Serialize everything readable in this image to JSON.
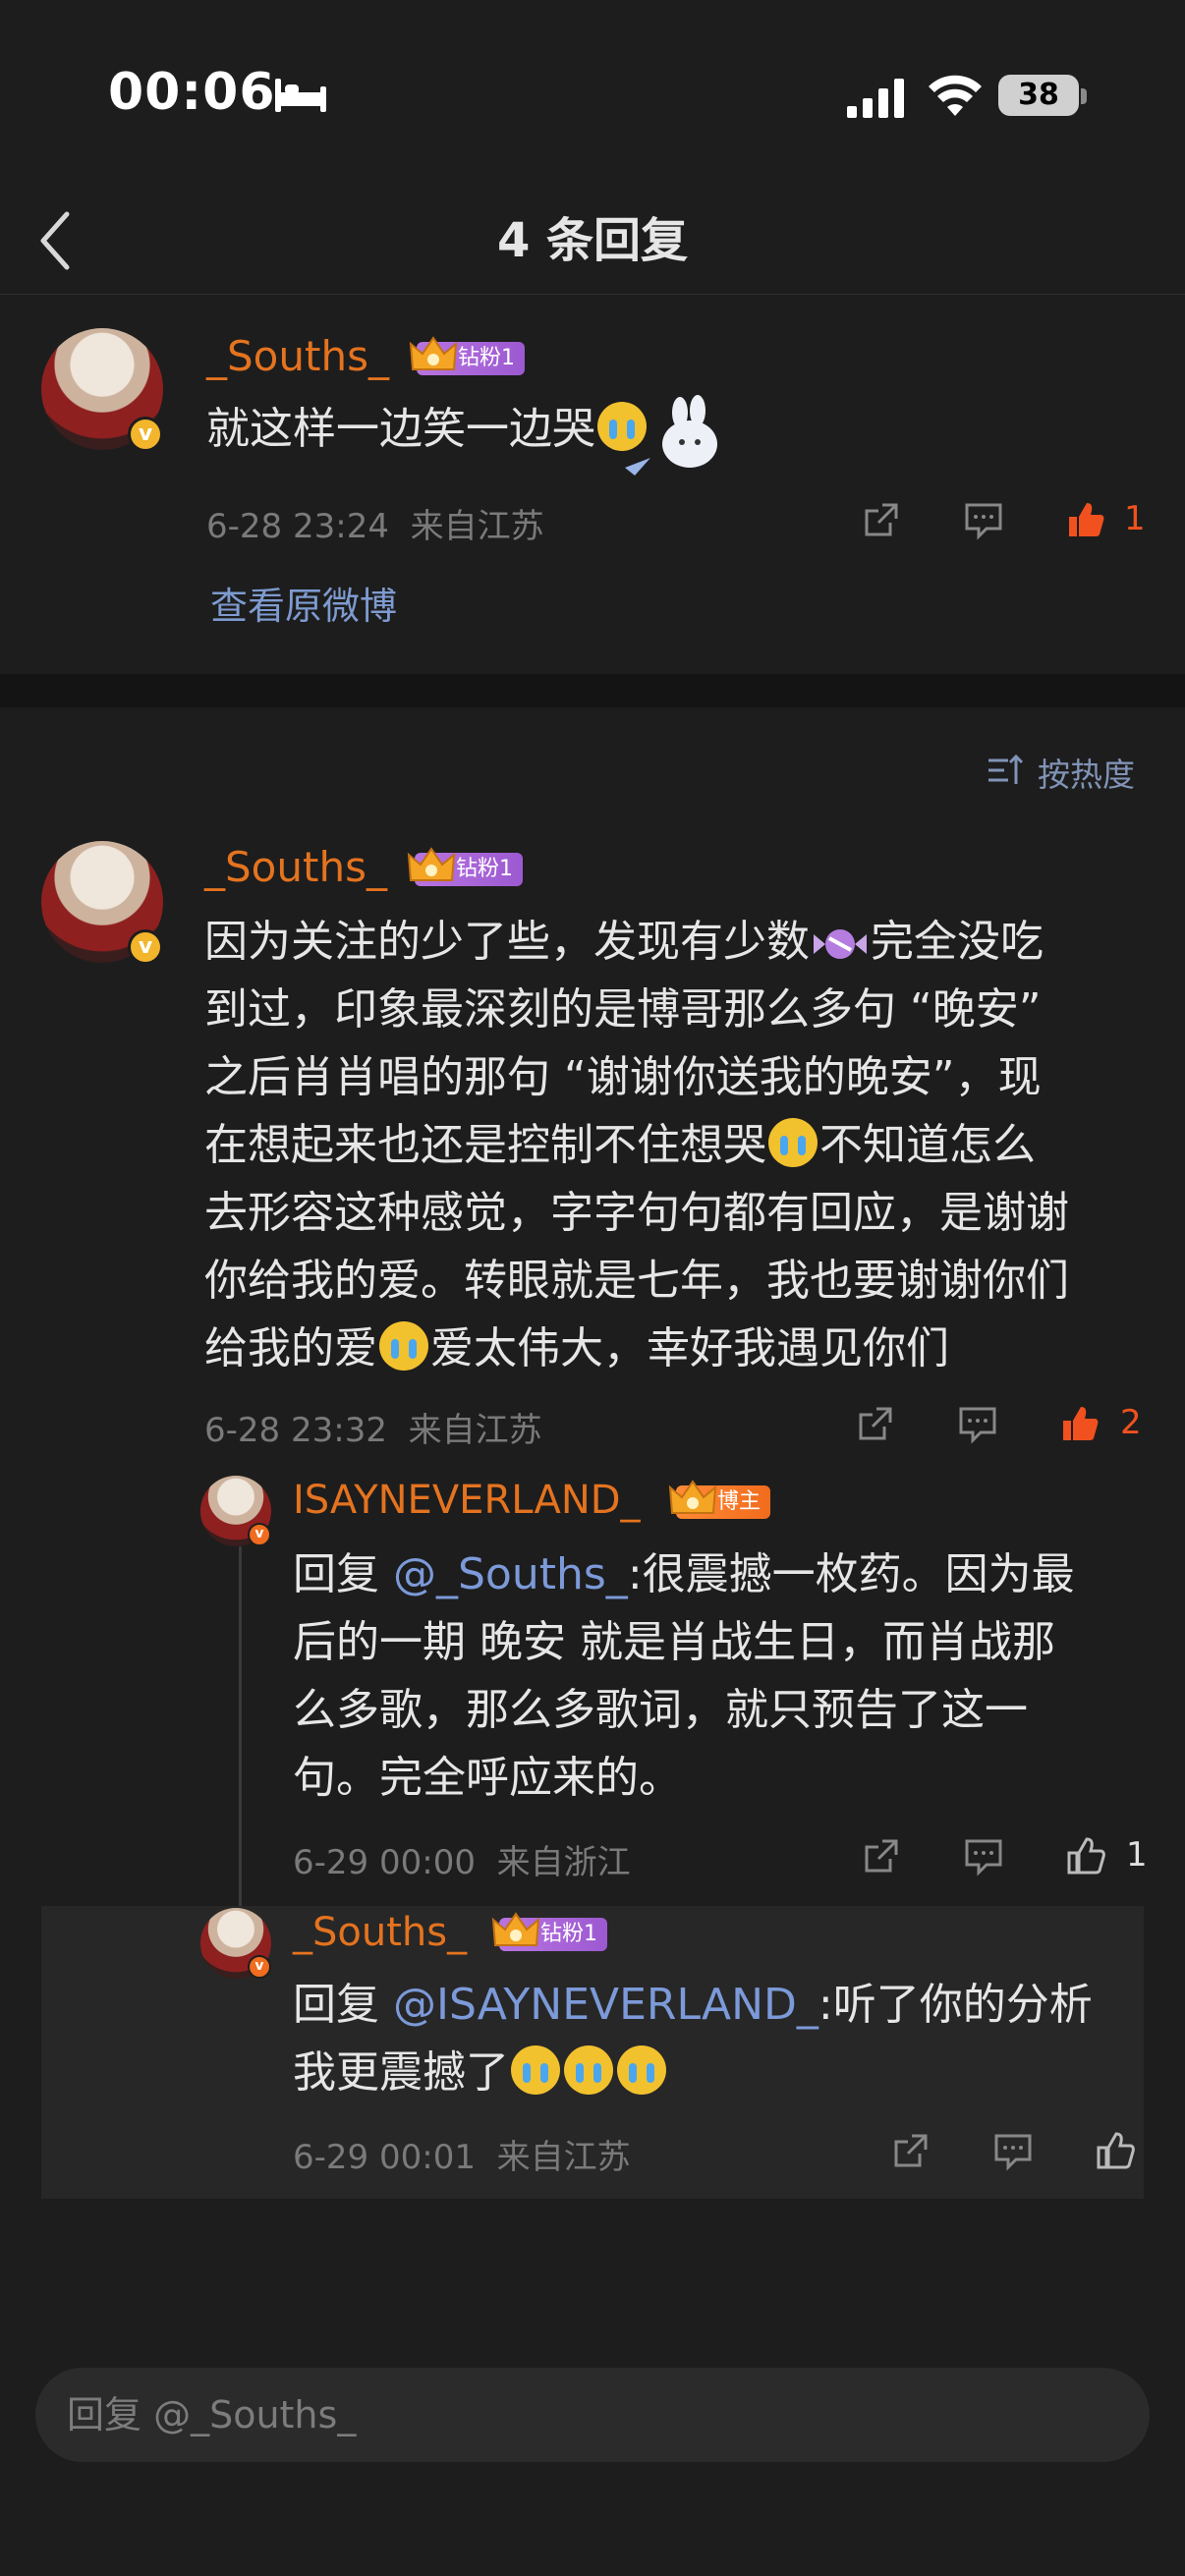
{
  "status": {
    "time": "00:06",
    "battery": "38"
  },
  "nav": {
    "title": "4 条回复"
  },
  "original": {
    "username": "_Souths_",
    "badge": "钻粉1",
    "text": "就这样一边笑一边哭",
    "date": "6-28 23:24",
    "location": "来自江苏",
    "likes": "1",
    "view_original": "查看原微博"
  },
  "sort": {
    "label": "按热度"
  },
  "comment": {
    "username": "_Souths_",
    "badge": "钻粉1",
    "lines": [
      "因为关注的少了些，发现有少数",
      "完全没吃",
      "到过，印象最深刻的是博哥那么多句 “晚安”",
      "之后肖肖唱的那句 “谢谢你送我的晚安”，现",
      "在想起来也还是控制不住想哭",
      "不知道怎么",
      "去形容这种感觉，字字句句都有回应，是谢谢",
      "你给我的爱。转眼就是七年，我也要谢谢你们",
      "给我的爱",
      "爱太伟大，幸好我遇见你们"
    ],
    "date": "6-28 23:32",
    "location": "来自江苏",
    "likes": "2"
  },
  "replies": [
    {
      "username": "ISAYNEVERLAND_",
      "badge": "博主",
      "prefix": "回复 ",
      "mention": "@_Souths_",
      "lines": [
        ":很震撼一枚药。因为最",
        "后的一期 晚安 就是肖战生日，而肖战那",
        "么多歌，那么多歌词，就只预告了这一",
        "句。完全呼应来的。"
      ],
      "date": "6-29 00:00",
      "location": "来自浙江",
      "likes": "1"
    },
    {
      "username": "_Souths_",
      "badge": "钻粉1",
      "prefix": "回复 ",
      "mention": "@ISAYNEVERLAND_",
      "lines": [
        ":听了你的分析",
        "我更震撼了"
      ],
      "date": "6-29 00:01",
      "location": "来自江苏"
    }
  ],
  "reply_input": {
    "placeholder": "回复 @_Souths_"
  },
  "colors": {
    "accent_orange": "#e4731f",
    "like_red": "#f0511e",
    "mention_blue": "#7c9ad9",
    "background": "#1d1d1d"
  },
  "icons": [
    "back-icon",
    "share-icon",
    "comment-icon",
    "like-icon",
    "sort-icon",
    "crown-icon",
    "cry-emoji",
    "candy-emoji"
  ]
}
